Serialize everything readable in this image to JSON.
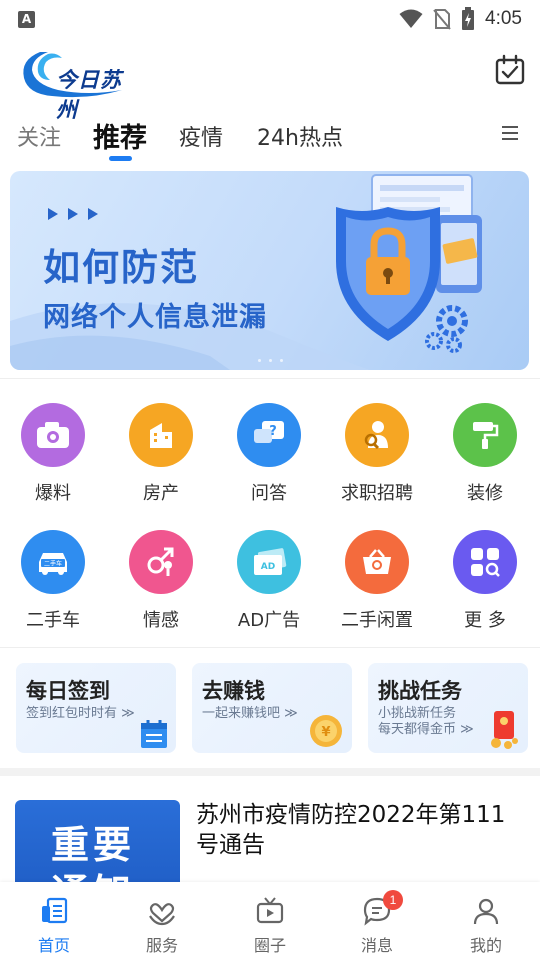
{
  "status_bar": {
    "notification_glyph": "A",
    "time": "4:05",
    "icons": [
      "wifi-icon",
      "no-sim-icon",
      "battery-charging-icon"
    ]
  },
  "header": {
    "logo_text": "今日苏州",
    "calendar_icon": "calendar-check-icon"
  },
  "tabs": {
    "items": [
      "关注",
      "推荐",
      "疫情",
      "24h热点"
    ],
    "active": "推荐",
    "menu_icon": "menu-icon"
  },
  "banner": {
    "line1": "如何防范",
    "line2": "网络个人信息泄漏"
  },
  "services": {
    "items": [
      {
        "label": "爆料",
        "icon": "camera-icon",
        "color": "#b36be0"
      },
      {
        "label": "房产",
        "icon": "building-icon",
        "color": "#f6a623"
      },
      {
        "label": "问答",
        "icon": "question-chat-icon",
        "color": "#2f8df0"
      },
      {
        "label": "求职招聘",
        "icon": "job-search-icon",
        "color": "#f6a623"
      },
      {
        "label": "装修",
        "icon": "paint-roller-icon",
        "color": "#5cc24a"
      },
      {
        "label": "二手车",
        "icon": "used-car-icon",
        "color": "#2f8df0"
      },
      {
        "label": "情感",
        "icon": "gender-icon",
        "color": "#f0568f"
      },
      {
        "label": "AD广告",
        "icon": "ad-icon",
        "color": "#3ec0e0"
      },
      {
        "label": "二手闲置",
        "icon": "basket-icon",
        "color": "#f46b3d"
      },
      {
        "label": "更 多",
        "icon": "more-grid-icon",
        "color": "#6a5af0"
      }
    ]
  },
  "cards": [
    {
      "title": "每日签到",
      "sub1": "签到红包时时有",
      "sub2": "",
      "arrow": "≫",
      "icon": "calendar-icon"
    },
    {
      "title": "去赚钱",
      "sub1": "一起来赚钱吧",
      "sub2": "",
      "arrow": "≫",
      "icon": "coin-icon"
    },
    {
      "title": "挑战任务",
      "sub1": "小挑战新任务",
      "sub2": "每天都得金币",
      "arrow": "≫",
      "icon": "red-envelope-icon"
    }
  ],
  "news": {
    "thumb_line1": "重要",
    "thumb_line2": "通知",
    "title": "苏州市疫情防控2022年第111号通告"
  },
  "bottom_nav": {
    "items": [
      {
        "label": "首页",
        "icon": "home-doc-icon"
      },
      {
        "label": "服务",
        "icon": "heart-hands-icon"
      },
      {
        "label": "圈子",
        "icon": "tv-icon"
      },
      {
        "label": "消息",
        "icon": "chat-icon"
      },
      {
        "label": "我的",
        "icon": "user-icon"
      }
    ],
    "active": "首页",
    "message_badge": "1"
  },
  "colors": {
    "accent": "#1d7cf2",
    "badge": "#f04a3e",
    "banner_text": "#2764c9"
  }
}
